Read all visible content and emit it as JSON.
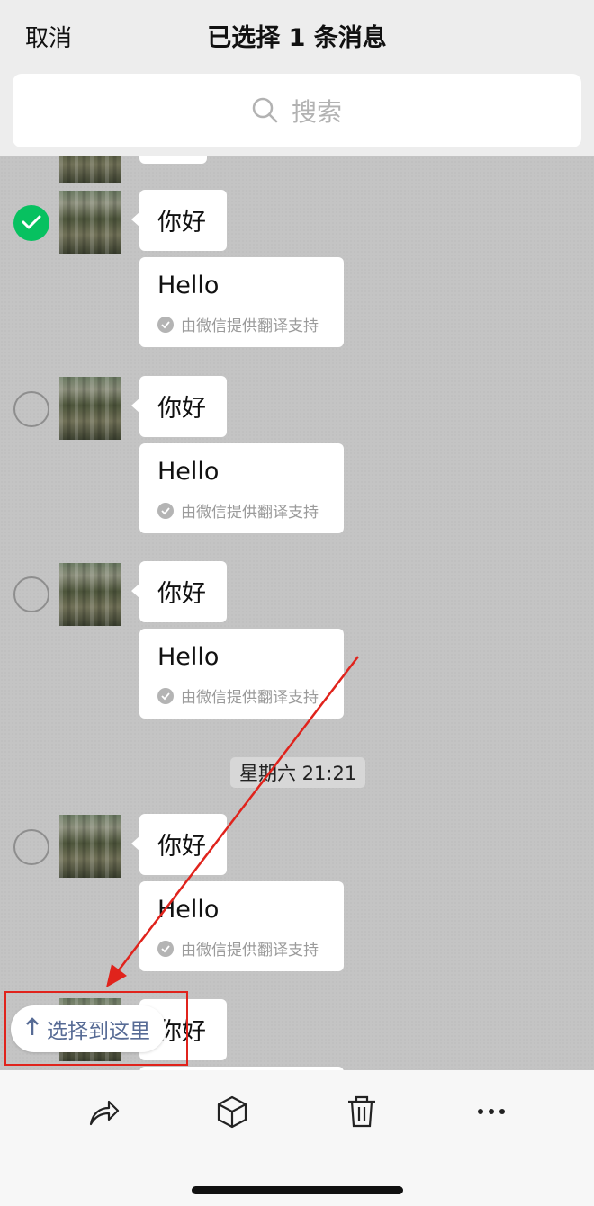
{
  "header": {
    "cancel_label": "取消",
    "title": "已选择 1 条消息",
    "search_placeholder": "搜索"
  },
  "messages": [
    {
      "selected": true,
      "text": "你好",
      "translation": "Hello",
      "translation_note": "由微信提供翻译支持"
    },
    {
      "selected": false,
      "text": "你好",
      "translation": "Hello",
      "translation_note": "由微信提供翻译支持"
    },
    {
      "selected": false,
      "text": "你好",
      "translation": "Hello",
      "translation_note": "由微信提供翻译支持"
    },
    {
      "selected": false,
      "text": "你好",
      "translation": "Hello",
      "translation_note": "由微信提供翻译支持"
    },
    {
      "text": "你好"
    }
  ],
  "timestamp": "星期六 21:21",
  "select_here_label": "选择到这里",
  "toolbar": {
    "icons": [
      "share-icon",
      "box-icon",
      "trash-icon",
      "more-icon"
    ]
  },
  "colors": {
    "accent_green": "#07c160",
    "link_blue": "#576b95",
    "annotation_red": "#e0231c"
  }
}
